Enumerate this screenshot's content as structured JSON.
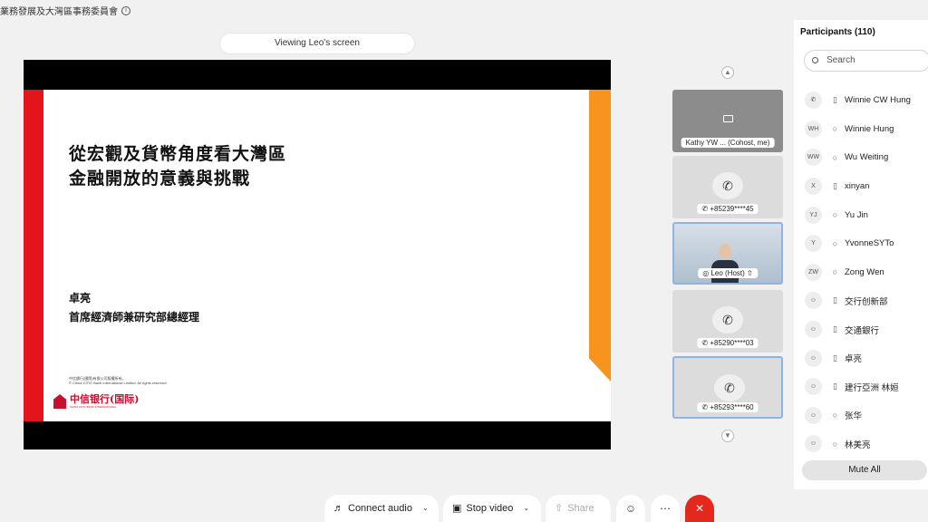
{
  "header": {
    "meeting_title": "業務發展及大灣區事務委員會"
  },
  "viewing_label": "Viewing Leo's screen",
  "slide": {
    "title_line1": "從宏觀及貨幣角度看大灣區",
    "title_line2": "金融開放的意義與挑戰",
    "presenter_name": "卓亮",
    "presenter_role": "首席經濟師兼研究部總經理",
    "copyright_cn": "中信銀行(國際)有限公司版權所有。",
    "copyright_en": "© China CITIC Bank International Limited. All rights reserved.",
    "logo_cn": "中信银行(国际)",
    "logo_en": "CHINA CITIC BANK INTERNATIONAL"
  },
  "video_tiles": [
    {
      "label": "Kathy YW ... (Cohost, me)",
      "type": "screen"
    },
    {
      "label": "+85239****45",
      "type": "phone"
    },
    {
      "label": "Leo (Host)",
      "type": "video"
    },
    {
      "label": "+85290****03",
      "type": "phone"
    },
    {
      "label": "+85293****60",
      "type": "phone"
    }
  ],
  "participants_panel": {
    "title": "Participants (110)",
    "search_placeholder": "Search",
    "mute_all_label": "Mute All",
    "items": [
      {
        "avatar": "",
        "avatar_icon": "phone-icon",
        "device": "mobile-icon",
        "name": "Winnie CW Hung"
      },
      {
        "avatar": "WH",
        "device": "headset-icon",
        "name": "Winnie Hung"
      },
      {
        "avatar": "WW",
        "device": "headset-icon",
        "name": "Wu Weiting"
      },
      {
        "avatar": "X",
        "device": "mobile-icon",
        "name": "xinyan"
      },
      {
        "avatar": "YJ",
        "device": "headset-icon",
        "name": "Yu Jin"
      },
      {
        "avatar": "Y",
        "device": "headset-icon",
        "name": "YvonneSYTo"
      },
      {
        "avatar": "ZW",
        "device": "headset-icon",
        "name": "Zong Wen"
      },
      {
        "avatar": "",
        "avatar_icon": "user-icon",
        "device": "mobile-icon",
        "name": "交行创新部"
      },
      {
        "avatar": "",
        "avatar_icon": "user-icon",
        "device": "mobile-icon",
        "name": "交通銀行"
      },
      {
        "avatar": "",
        "avatar_icon": "user-icon",
        "device": "mobile-icon",
        "name": "卓亮"
      },
      {
        "avatar": "",
        "avatar_icon": "user-icon",
        "device": "mobile-icon",
        "name": "建行亞洲 林姮"
      },
      {
        "avatar": "",
        "avatar_icon": "user-icon",
        "device": "headset-icon",
        "name": "张华"
      },
      {
        "avatar": "",
        "avatar_icon": "user-icon",
        "device": "headset-icon",
        "name": "林美亮"
      }
    ]
  },
  "toolbar": {
    "connect_audio_label": "Connect audio",
    "stop_video_label": "Stop video",
    "share_label": "Share"
  },
  "colors": {
    "slide_red": "#e4141b",
    "slide_orange": "#f7941d",
    "end_button": "#e5281e",
    "selected_tile_border": "#8fb3e6"
  }
}
